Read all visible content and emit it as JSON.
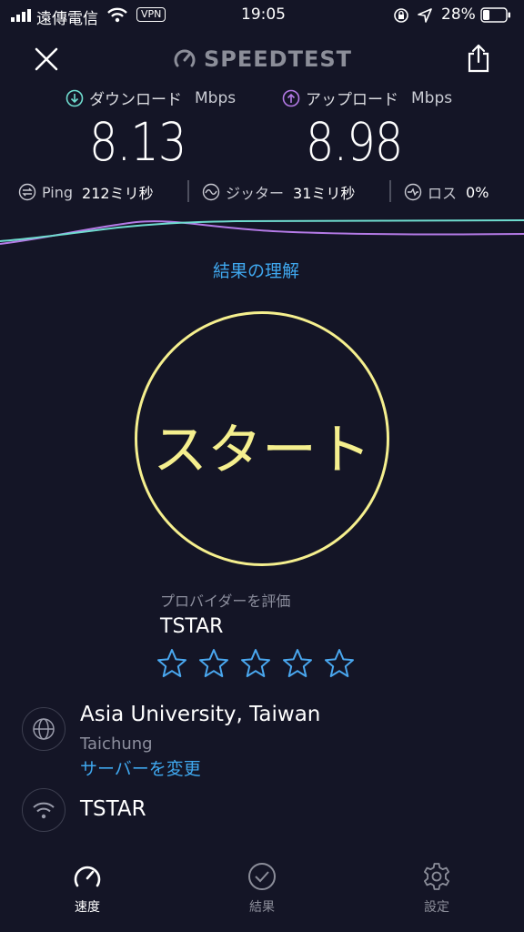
{
  "status_bar": {
    "carrier": "遠傳電信",
    "vpn": "VPN",
    "time": "19:05",
    "battery": "28%"
  },
  "header": {
    "logo": "SPEEDTEST"
  },
  "download": {
    "label": "ダウンロード",
    "unit": "Mbps",
    "value": "8.13"
  },
  "upload": {
    "label": "アップロード",
    "unit": "Mbps",
    "value": "8.98"
  },
  "metrics": {
    "ping": {
      "label": "Ping",
      "value": "212ミリ秒"
    },
    "jitter": {
      "label": "ジッター",
      "value": "31ミリ秒"
    },
    "loss": {
      "label": "ロス",
      "value": "0%"
    }
  },
  "understand_link": "結果の理解",
  "start_label": "スタート",
  "provider": {
    "caption": "プロバイダーを評価",
    "name": "TSTAR",
    "star_count": 5
  },
  "server": {
    "name": "Asia University, Taiwan",
    "city": "Taichung",
    "change_label": "サーバーを変更"
  },
  "network": {
    "name": "TSTAR"
  },
  "tabs": [
    {
      "label": "速度",
      "icon": "speedometer-icon",
      "active": true
    },
    {
      "label": "結果",
      "icon": "check-circle-icon",
      "active": false
    },
    {
      "label": "設定",
      "icon": "gear-icon",
      "active": false
    }
  ],
  "colors": {
    "background": "#141526",
    "download": "#6fdccf",
    "upload": "#b47ae6",
    "start": "#f5ef8e",
    "link": "#3fa7ee",
    "star": "#4aa8f0"
  }
}
